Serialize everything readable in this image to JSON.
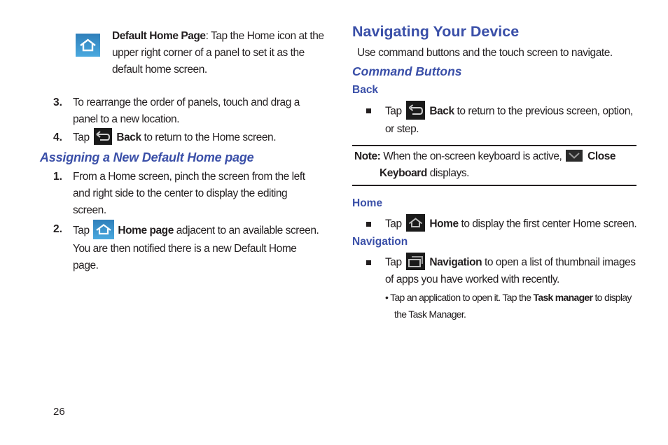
{
  "left": {
    "default_home": {
      "icon": "home-icon-blue",
      "bold": "Default Home Page",
      "text": ": Tap the Home icon at the",
      "line2": "upper right corner of a panel to set it as the",
      "line3": "default home screen."
    },
    "steps_a": [
      {
        "num": "3.",
        "line1": "To rearrange the order of panels, touch and drag a",
        "line2": "panel to a new location."
      },
      {
        "num": "4.",
        "pre": "Tap",
        "icon": "back-icon",
        "bold": "Back",
        "post": "to return to the Home screen."
      }
    ],
    "section_heading": "Assigning a New Default Home page",
    "steps_b": [
      {
        "num": "1.",
        "line1": "From a Home screen, pinch the screen from the left",
        "line2": "and right side to the center to display the editing",
        "line3": "screen."
      },
      {
        "num": "2.",
        "pre": "Tap",
        "icon": "home-icon-blue",
        "bold": "Home page",
        "post": "adjacent to an available screen.",
        "line2": "You are then notified there is a new Default Home",
        "line3": "page."
      }
    ]
  },
  "right": {
    "title": "Navigating Your Device",
    "intro": "Use command buttons and the touch screen to navigate.",
    "subheading": "Command Buttons",
    "back": {
      "heading": "Back",
      "pre": "Tap",
      "icon": "back-icon",
      "bold": "Back",
      "post": "to return to the previous screen, option,",
      "line2": "or step."
    },
    "note": {
      "label": "Note:",
      "text": "When the on-screen keyboard is active,",
      "icon": "close-keyboard-icon",
      "bold1": "Close",
      "bold2": "Keyboard",
      "post": "displays."
    },
    "home": {
      "heading": "Home",
      "pre": "Tap",
      "icon": "home-icon-dark",
      "bold": "Home",
      "post": "to display the first center Home screen."
    },
    "navigation": {
      "heading": "Navigation",
      "pre": "Tap",
      "icon": "recent-apps-icon",
      "bold": "Navigation",
      "post": "to open a list of thumbnail images",
      "line2": "of apps you have worked with recently.",
      "sub_bullet": {
        "pre": "Tap an application to open it. Tap the",
        "bold": "Task manager",
        "post": "to display",
        "line2": "the Task Manager."
      }
    }
  },
  "footer": {
    "page_number": "26"
  },
  "colors": {
    "heading_blue": "#3a4fa8",
    "home_icon_blue": "#3d9ad6",
    "icon_dark": "#1a1a1a"
  }
}
